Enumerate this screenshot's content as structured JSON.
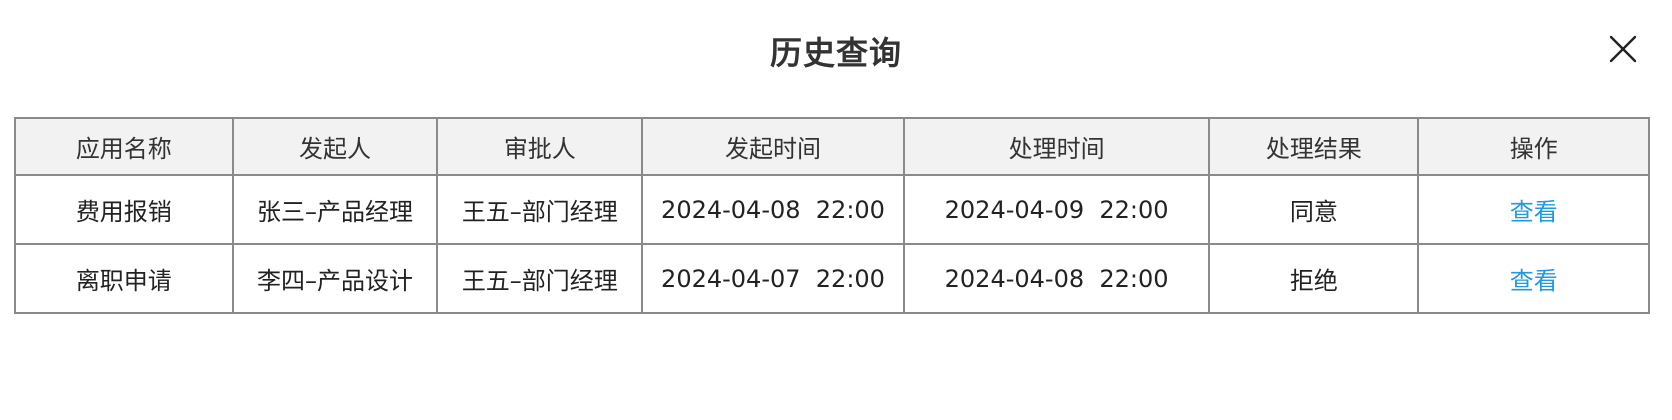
{
  "dialog": {
    "title": "历史查询",
    "close_icon": "close-icon"
  },
  "table": {
    "headers": [
      "应用名称",
      "发起人",
      "审批人",
      "发起时间",
      "处理时间",
      "处理结果",
      "操作"
    ],
    "rows": [
      {
        "app_name": "费用报销",
        "initiator": "张三–产品经理",
        "approver": "王五–部门经理",
        "start_time": "2024-04-08  22:00",
        "handle_time": "2024-04-09  22:00",
        "result": "同意",
        "action": "查看"
      },
      {
        "app_name": "离职申请",
        "initiator": "李四–产品设计",
        "approver": "王五–部门经理",
        "start_time": "2024-04-07  22:00",
        "handle_time": "2024-04-08  22:00",
        "result": "拒绝",
        "action": "查看"
      }
    ]
  },
  "colors": {
    "link": "#1f9ae0",
    "header_bg": "#f2f2f2",
    "border": "#8a8a8a"
  }
}
